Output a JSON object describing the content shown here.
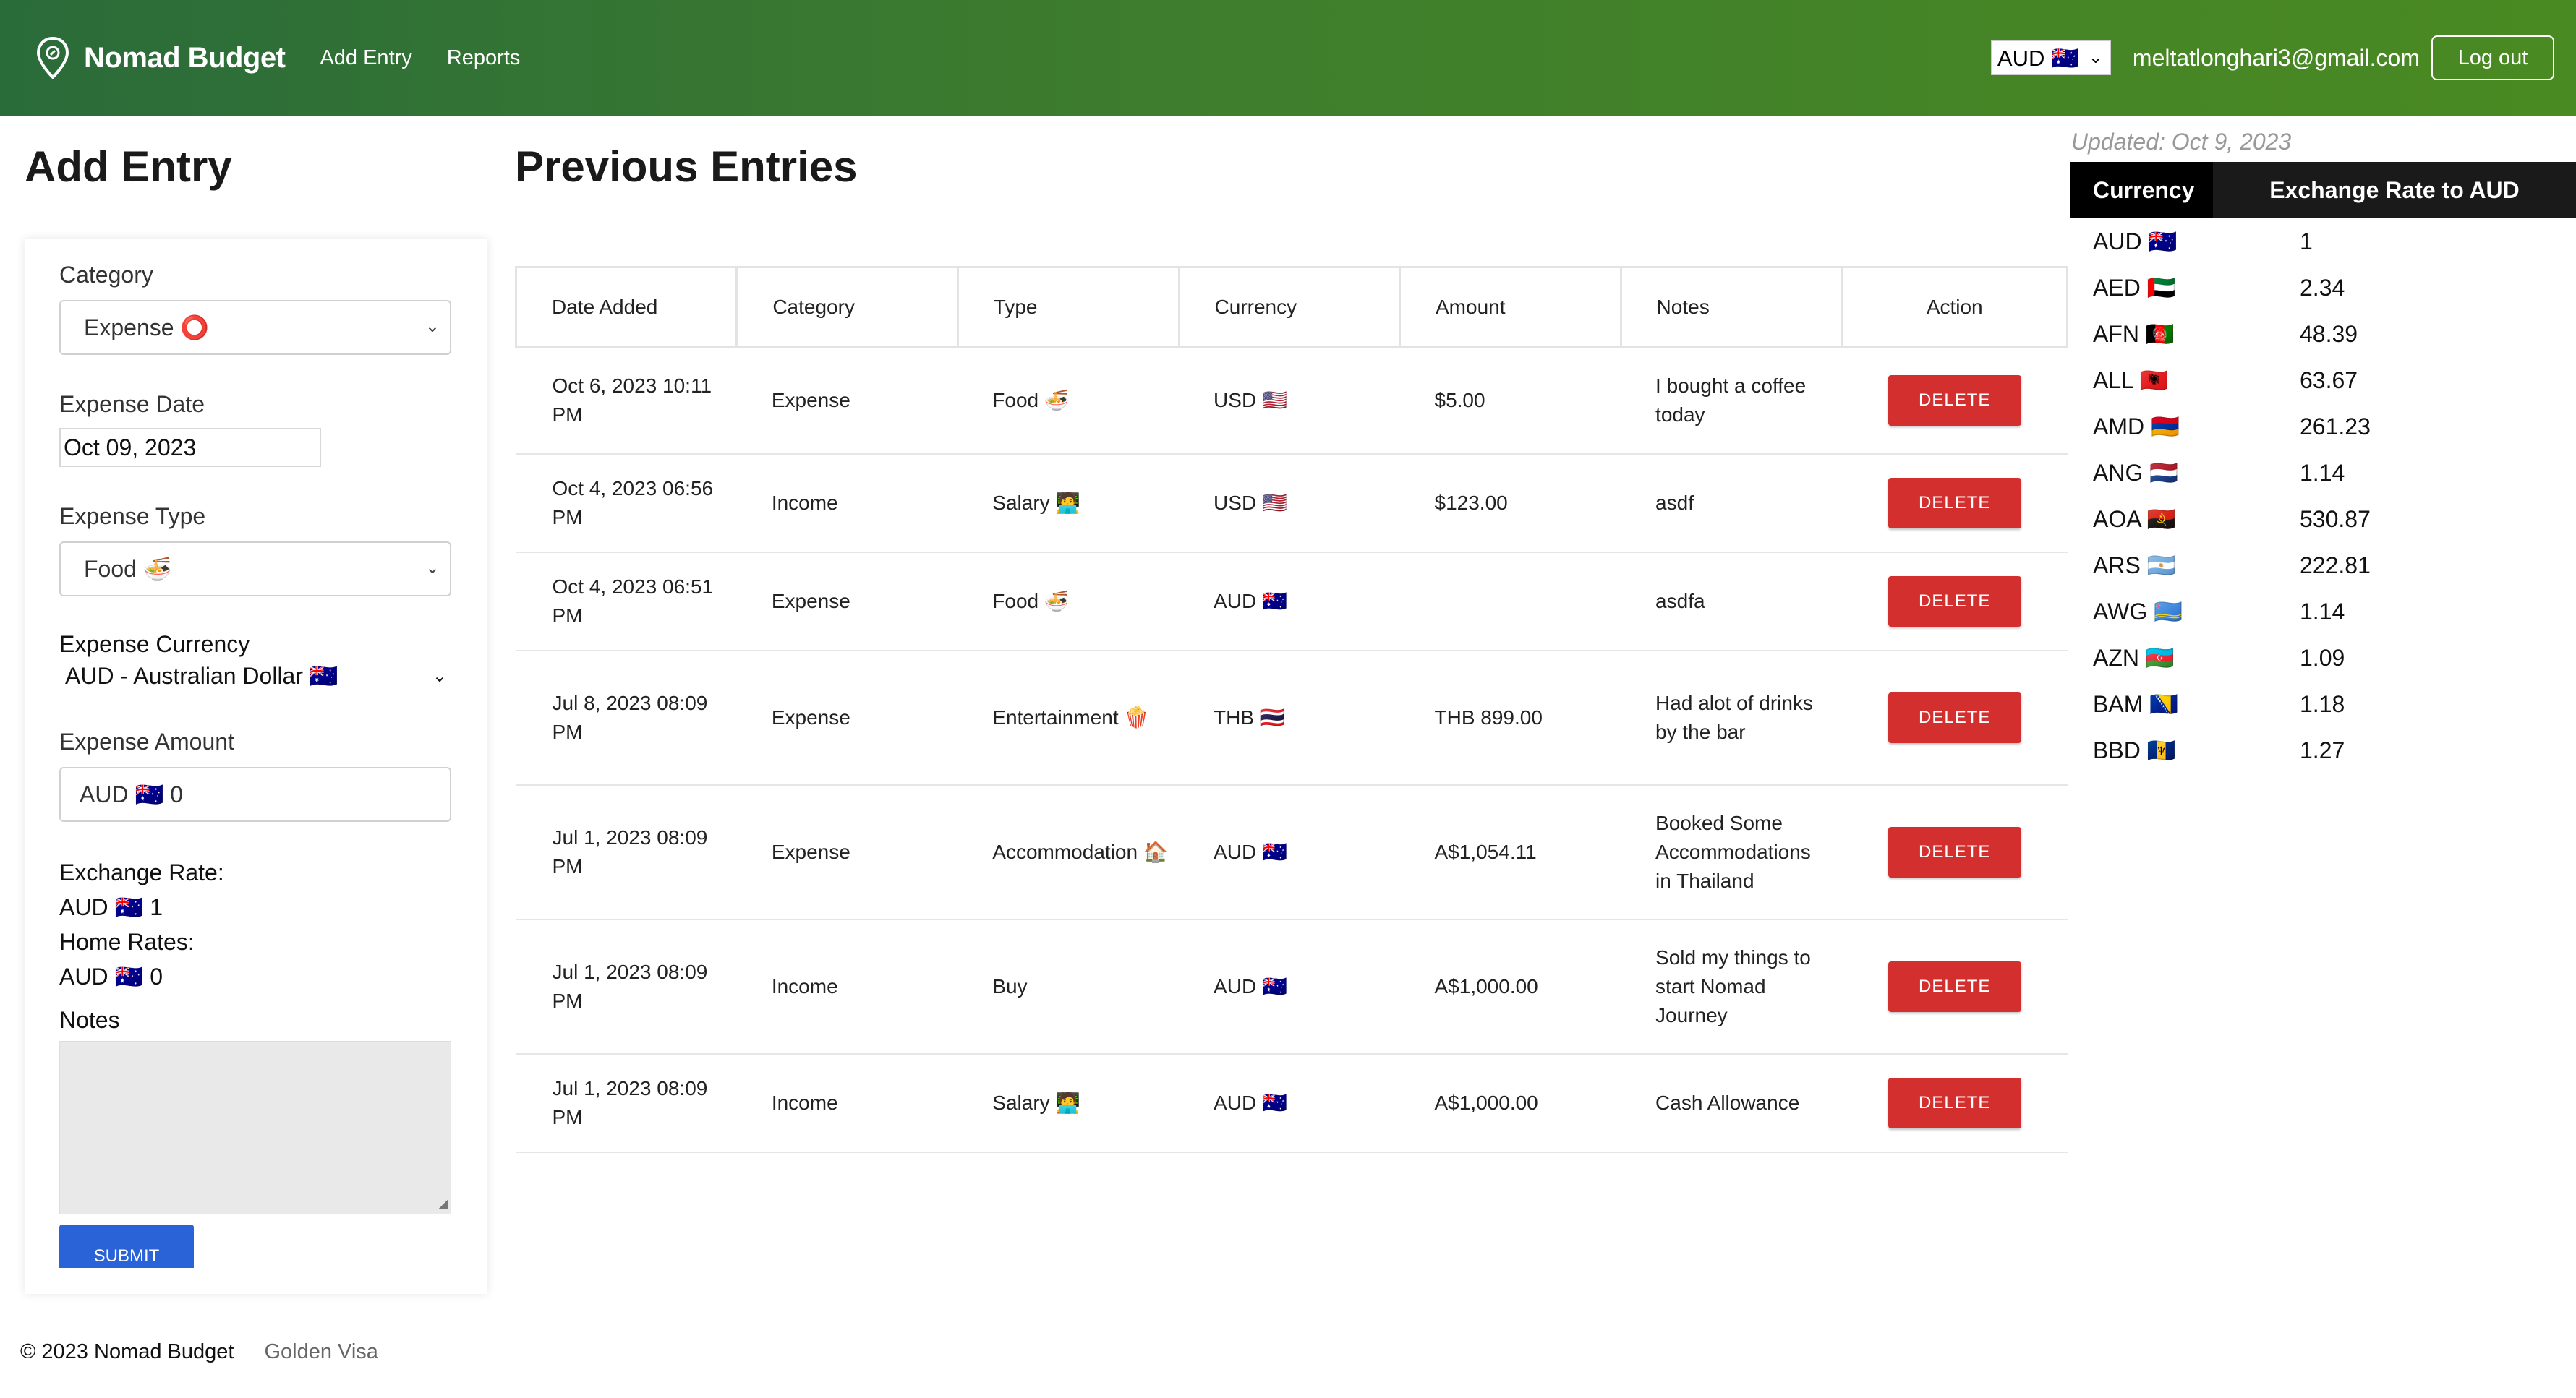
{
  "header": {
    "brand": "Nomad Budget",
    "nav": [
      "Add Entry",
      "Reports"
    ],
    "currency_select": "AUD 🇦🇺",
    "user_email": "meltatlonghari3@gmail.com",
    "logout_label": "Log out",
    "gradient_colors": [
      "#2a6b3a",
      "#4a8a22"
    ]
  },
  "add_entry": {
    "title": "Add Entry",
    "category_label": "Category",
    "category_value": "Expense ⭕",
    "date_label": "Expense Date",
    "date_value": "Oct 09, 2023",
    "type_label": "Expense Type",
    "type_value": "Food 🍜",
    "currency_label": "Expense Currency",
    "currency_value": "AUD - Australian Dollar 🇦🇺",
    "amount_label": "Expense Amount",
    "amount_value": "AUD 🇦🇺 0",
    "exchange_rate_label": "Exchange Rate:",
    "exchange_rate_value": "AUD 🇦🇺 1",
    "home_rates_label": "Home Rates:",
    "home_rates_value": "AUD 🇦🇺 0",
    "notes_label": "Notes",
    "submit_label": "SUBMIT"
  },
  "previous_entries": {
    "title": "Previous Entries",
    "columns": [
      "Date Added",
      "Category",
      "Type",
      "Currency",
      "Amount",
      "Notes",
      "Action"
    ],
    "rows": [
      {
        "date": "Oct 6, 2023 10:11 PM",
        "category": "Expense",
        "type": "Food 🍜",
        "currency": "USD 🇺🇸",
        "amount": "$5.00",
        "notes": "I bought a coffee today",
        "action": "DELETE"
      },
      {
        "date": "Oct 4, 2023 06:56 PM",
        "category": "Income",
        "type": "Salary 🧑‍💻",
        "currency": "USD 🇺🇸",
        "amount": "$123.00",
        "notes": "asdf",
        "action": "DELETE"
      },
      {
        "date": "Oct 4, 2023 06:51 PM",
        "category": "Expense",
        "type": "Food 🍜",
        "currency": "AUD 🇦🇺",
        "amount": "",
        "notes": "asdfa",
        "action": "DELETE"
      },
      {
        "date": "Jul 8, 2023 08:09 PM",
        "category": "Expense",
        "type": "Entertainment 🍿",
        "currency": "THB 🇹🇭",
        "amount": "THB 899.00",
        "notes": "Had alot of drinks by the bar",
        "action": "DELETE"
      },
      {
        "date": "Jul 1, 2023 08:09 PM",
        "category": "Expense",
        "type": "Accommodation 🏠",
        "currency": "AUD 🇦🇺",
        "amount": "A$1,054.11",
        "notes": "Booked Some Accommodations in Thailand",
        "action": "DELETE"
      },
      {
        "date": "Jul 1, 2023 08:09 PM",
        "category": "Income",
        "type": "Buy",
        "currency": "AUD 🇦🇺",
        "amount": "A$1,000.00",
        "notes": "Sold my things to start Nomad Journey",
        "action": "DELETE"
      },
      {
        "date": "Jul 1, 2023 08:09 PM",
        "category": "Income",
        "type": "Salary 🧑‍💻",
        "currency": "AUD 🇦🇺",
        "amount": "A$1,000.00",
        "notes": "Cash Allowance",
        "action": "DELETE"
      }
    ]
  },
  "rates": {
    "updated": "Updated: Oct 9, 2023",
    "col_currency": "Currency",
    "col_rate": "Exchange Rate to AUD",
    "items": [
      {
        "code": "AUD 🇦🇺",
        "rate": "1"
      },
      {
        "code": "AED 🇦🇪",
        "rate": "2.34"
      },
      {
        "code": "AFN 🇦🇫",
        "rate": "48.39"
      },
      {
        "code": "ALL 🇦🇱",
        "rate": "63.67"
      },
      {
        "code": "AMD 🇦🇲",
        "rate": "261.23"
      },
      {
        "code": "ANG 🇳🇱",
        "rate": "1.14"
      },
      {
        "code": "AOA 🇦🇴",
        "rate": "530.87"
      },
      {
        "code": "ARS 🇦🇷",
        "rate": "222.81"
      },
      {
        "code": "AWG 🇦🇼",
        "rate": "1.14"
      },
      {
        "code": "AZN 🇦🇿",
        "rate": "1.09"
      },
      {
        "code": "BAM 🇧🇦",
        "rate": "1.18"
      },
      {
        "code": "BBD 🇧🇧",
        "rate": "1.27"
      }
    ]
  },
  "footer": {
    "copyright": "© 2023 Nomad Budget",
    "link": "Golden Visa"
  },
  "colors": {
    "expense": "#d32f2f",
    "income": "#2e8b3a",
    "delete_button": "#d32f2f",
    "submit_button": "#2a63d8"
  }
}
